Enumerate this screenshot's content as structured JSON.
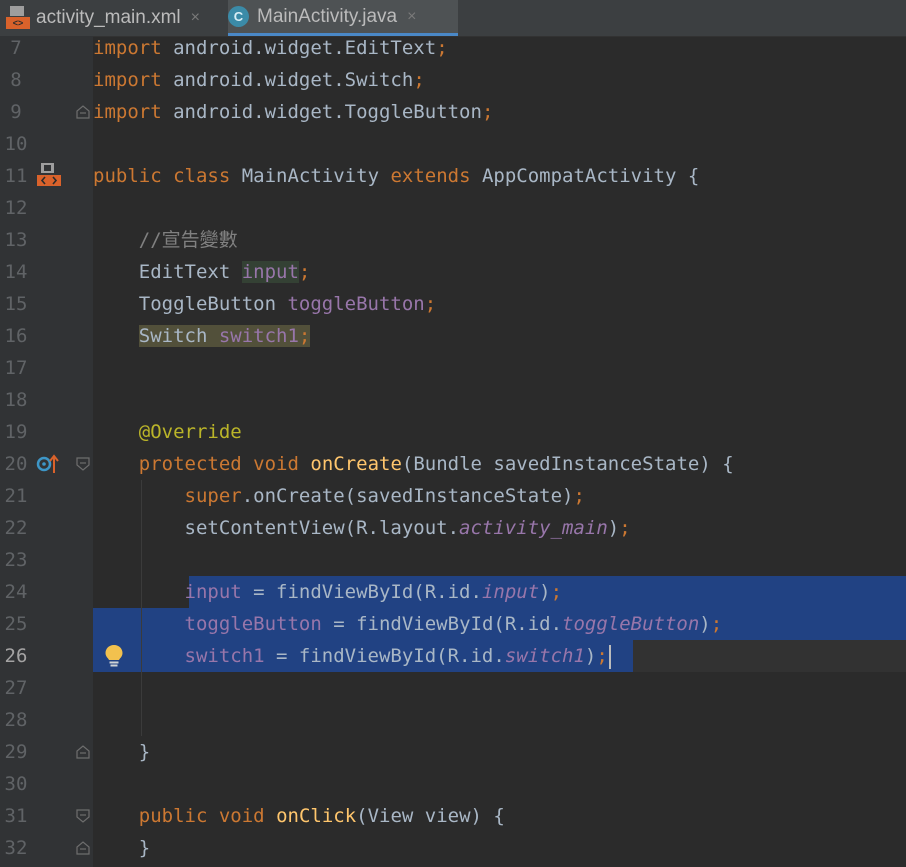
{
  "tabs": [
    {
      "label": "activity_main.xml",
      "icon": "xml-layout-icon",
      "active": false
    },
    {
      "label": "MainActivity.java",
      "icon": "java-class-icon",
      "active": true
    }
  ],
  "close_glyph": "×",
  "editor": {
    "current_line": 26,
    "lines": [
      {
        "n": "7",
        "text": "import android.widget.EditText;"
      },
      {
        "n": "8",
        "text": "import android.widget.Switch;"
      },
      {
        "n": "9",
        "text": "import android.widget.ToggleButton;"
      },
      {
        "n": "10",
        "text": ""
      },
      {
        "n": "11",
        "text": "public class MainActivity extends AppCompatActivity {"
      },
      {
        "n": "12",
        "text": ""
      },
      {
        "n": "13",
        "text": "    //宣告變數"
      },
      {
        "n": "14",
        "text": "    EditText input;"
      },
      {
        "n": "15",
        "text": "    ToggleButton toggleButton;"
      },
      {
        "n": "16",
        "text": "    Switch switch1;"
      },
      {
        "n": "17",
        "text": ""
      },
      {
        "n": "18",
        "text": ""
      },
      {
        "n": "19",
        "text": "    @Override"
      },
      {
        "n": "20",
        "text": "    protected void onCreate(Bundle savedInstanceState) {"
      },
      {
        "n": "21",
        "text": "        super.onCreate(savedInstanceState);"
      },
      {
        "n": "22",
        "text": "        setContentView(R.layout.activity_main);"
      },
      {
        "n": "23",
        "text": ""
      },
      {
        "n": "24",
        "text": "        input = findViewById(R.id.input);"
      },
      {
        "n": "25",
        "text": "        toggleButton = findViewById(R.id.toggleButton);"
      },
      {
        "n": "26",
        "text": "        switch1 = findViewById(R.id.switch1);"
      },
      {
        "n": "27",
        "text": ""
      },
      {
        "n": "28",
        "text": ""
      },
      {
        "n": "29",
        "text": "    }"
      },
      {
        "n": "30",
        "text": ""
      },
      {
        "n": "31",
        "text": "    public void onClick(View view) {"
      },
      {
        "n": "32",
        "text": "    }"
      }
    ]
  },
  "gutter_icons": {
    "line11": "xml-layout-icon",
    "line20": "override-method-icon",
    "line26": "lightbulb-intention-icon"
  },
  "colors": {
    "background": "#2b2b2b",
    "keyword": "#cc7832",
    "field": "#9876aa",
    "method": "#ffc66d",
    "annotation": "#bbb529",
    "comment": "#808080",
    "selection": "#214283"
  }
}
